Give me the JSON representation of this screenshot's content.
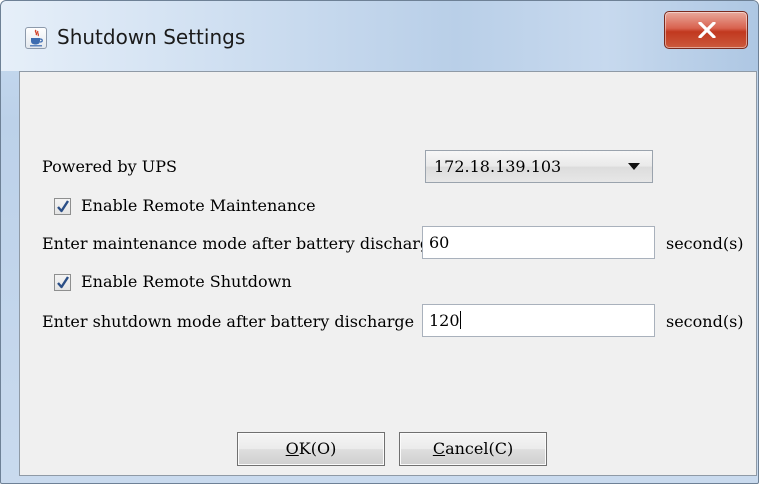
{
  "window": {
    "title": "Shutdown Settings"
  },
  "form": {
    "powered_by_label": "Powered by UPS",
    "ups_selected": "172.18.139.103",
    "enable_maintenance_label": "Enable Remote Maintenance",
    "enable_maintenance_checked": true,
    "maintenance_label": "Enter maintenance mode after battery discharge",
    "maintenance_value": "60",
    "maintenance_unit": "second(s)",
    "enable_shutdown_label": "Enable Remote Shutdown",
    "enable_shutdown_checked": true,
    "shutdown_label": "Enter shutdown mode after battery discharge",
    "shutdown_value": "120",
    "shutdown_unit": "second(s)"
  },
  "buttons": {
    "ok_mnemonic": "O",
    "ok_rest": "K(O)",
    "cancel_mnemonic": "C",
    "cancel_rest": "ancel(C)"
  },
  "colors": {
    "close_button": "#c7432a",
    "panel_background": "#f0f0f0",
    "check_mark": "#2a4e86"
  },
  "icons": {
    "app": "java-coffee-cup-icon",
    "close": "close-x-icon",
    "dropdown": "dropdown-arrow-icon",
    "checkbox": "checkmark-icon"
  }
}
